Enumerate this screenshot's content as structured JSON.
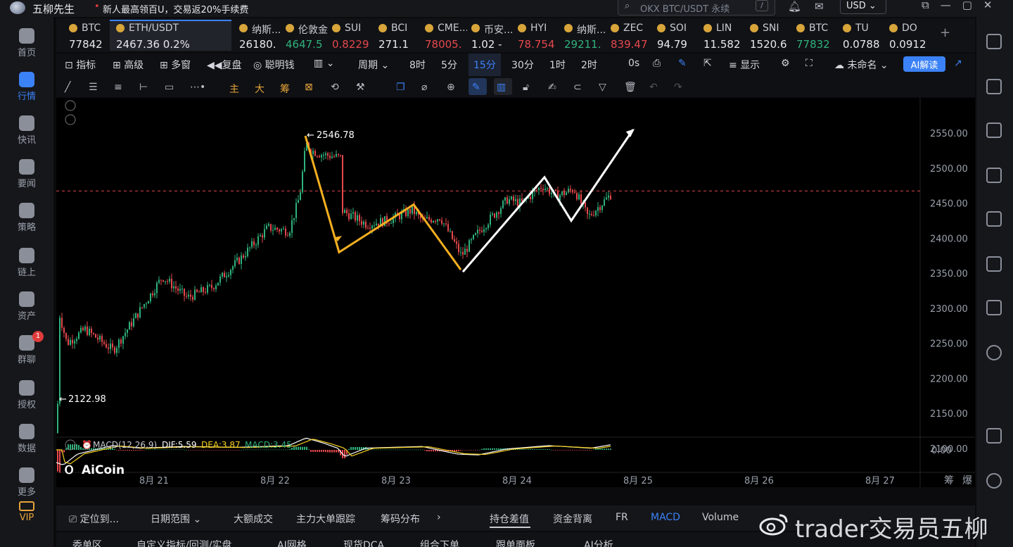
{
  "titlebar": {
    "app_name": "五柳先生",
    "promo": "新人最高领百U，交易返20%手续费",
    "search_placeholder": "OKX BTC/USDT 永续",
    "search_shortcut": "/",
    "currency": "USD"
  },
  "left_nav": [
    {
      "label": "首页",
      "icon": "home-icon"
    },
    {
      "label": "行情",
      "icon": "market-icon",
      "active": true
    },
    {
      "label": "快讯",
      "icon": "flash-news-icon"
    },
    {
      "label": "要闻",
      "icon": "news-icon"
    },
    {
      "label": "策略",
      "icon": "robot-icon"
    },
    {
      "label": "链上",
      "icon": "chain-icon"
    },
    {
      "label": "资产",
      "icon": "wallet-icon"
    },
    {
      "label": "群聊",
      "icon": "chat-icon",
      "badge": "1"
    },
    {
      "label": "授权",
      "icon": "key-icon"
    },
    {
      "label": "数据",
      "icon": "data-icon"
    },
    {
      "label": "更多",
      "icon": "more-icon"
    },
    {
      "label": "VIP",
      "icon": "vip-icon"
    }
  ],
  "tickers": [
    {
      "sym": "BTC",
      "price": "77842",
      "color": "white"
    },
    {
      "sym": "ETH/USDT",
      "price": "2467.36  0.2%",
      "color": "white",
      "active": true
    },
    {
      "sym": "纳斯...",
      "price": "26180.",
      "color": "white"
    },
    {
      "sym": "伦敦金",
      "price": "4647.5",
      "color": "green"
    },
    {
      "sym": "SUI",
      "price": "0.8229",
      "color": "red"
    },
    {
      "sym": "BCI",
      "price": "271.1",
      "color": "white"
    },
    {
      "sym": "CME...",
      "price": "78005.",
      "color": "red"
    },
    {
      "sym": "币安...",
      "price": "1.02 -",
      "color": "white"
    },
    {
      "sym": "HYI",
      "price": "78.754",
      "color": "red"
    },
    {
      "sym": "纳斯...",
      "price": "29211.",
      "color": "green"
    },
    {
      "sym": "ZEC",
      "price": "839.47",
      "color": "red"
    },
    {
      "sym": "SOI",
      "price": "94.79",
      "color": "white"
    },
    {
      "sym": "LIN",
      "price": "11.582",
      "color": "white"
    },
    {
      "sym": "SNI",
      "price": "1520.6",
      "color": "white"
    },
    {
      "sym": "BTC",
      "price": "77832",
      "color": "green"
    },
    {
      "sym": "TU",
      "price": "0.0788",
      "color": "white"
    },
    {
      "sym": "DO",
      "price": "0.0912",
      "color": "white"
    }
  ],
  "toolbar": {
    "indicators": "指标",
    "advanced": "高级",
    "multi_window": "多窗",
    "replay": "复盘",
    "smart_money": "聪明钱",
    "period": "周期",
    "timeframes": [
      "8时",
      "5分",
      "15分",
      "30分",
      "1时",
      "2时"
    ],
    "countdown": "0s",
    "display": "显示",
    "layout_name": "未命名",
    "ai_read": "AI解读"
  },
  "toolbar2": {
    "main": "主",
    "big": "大",
    "chips": "筹"
  },
  "chart": {
    "high_label": "2546.78",
    "low_label": "2122.98",
    "current_price": 2467.36,
    "y_ticks": [
      "2550.00",
      "2500.00",
      "2450.00",
      "2400.00",
      "2350.00",
      "2300.00",
      "2250.00",
      "2200.00",
      "2150.00",
      "2100.00"
    ],
    "x_ticks": [
      "8月 21",
      "8月 22",
      "8月 23",
      "8月 24",
      "8月 25",
      "8月 26",
      "8月 27"
    ],
    "macd_label": "MACD(12,26,9)",
    "macd_dif": "DIF:5.59",
    "macd_dea": "DEA:3.87",
    "macd_val": "MACD:3.45",
    "macd_zero": "0.00",
    "brand": "AiCoin",
    "corner_labels": [
      "筹",
      "爆"
    ],
    "up_color": "#2fb27c",
    "down_color": "#e5484d",
    "orange_color": "#f5b021"
  },
  "bottombar": {
    "locate": "定位到...",
    "date_range": "日期范围",
    "items": [
      "大额成交",
      "主力大单跟踪",
      "筹码分布"
    ],
    "right_items": [
      "持仓差值",
      "资金背离",
      "FR",
      "MACD",
      "Volume"
    ],
    "right_selected": "MACD"
  },
  "bottom_tabs": [
    "委单区",
    "自定义指标/回测/实盘",
    "AI网格",
    "现货DCA",
    "组合下单",
    "跟单面板",
    "AI分析"
  ],
  "watermark": "trader交易员五柳"
}
